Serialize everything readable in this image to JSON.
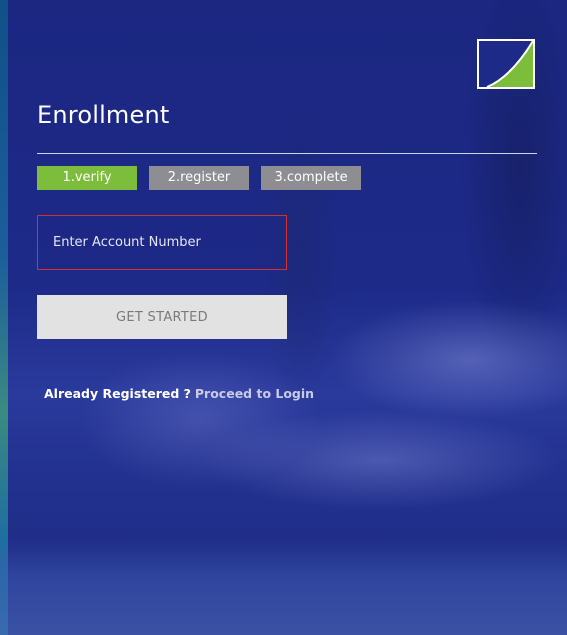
{
  "page": {
    "title": "Enrollment"
  },
  "logo": {
    "icon": "bank-logo-icon",
    "accent_color": "#7cbd3c"
  },
  "steps": [
    {
      "label": "1.verify",
      "active": true
    },
    {
      "label": "2.register",
      "active": false
    },
    {
      "label": "3.complete",
      "active": false
    }
  ],
  "form": {
    "account_number": {
      "value": "",
      "placeholder": "Enter Account Number"
    },
    "submit_label": "GET STARTED"
  },
  "footer": {
    "question": "Already Registered ?",
    "login_link": "Proceed to Login"
  },
  "colors": {
    "background": "#1c2a86",
    "step_active": "#7cbd3c",
    "step_inactive": "#8e8e92",
    "input_border_error": "#d7302c",
    "button_bg": "#e2e2e2"
  }
}
